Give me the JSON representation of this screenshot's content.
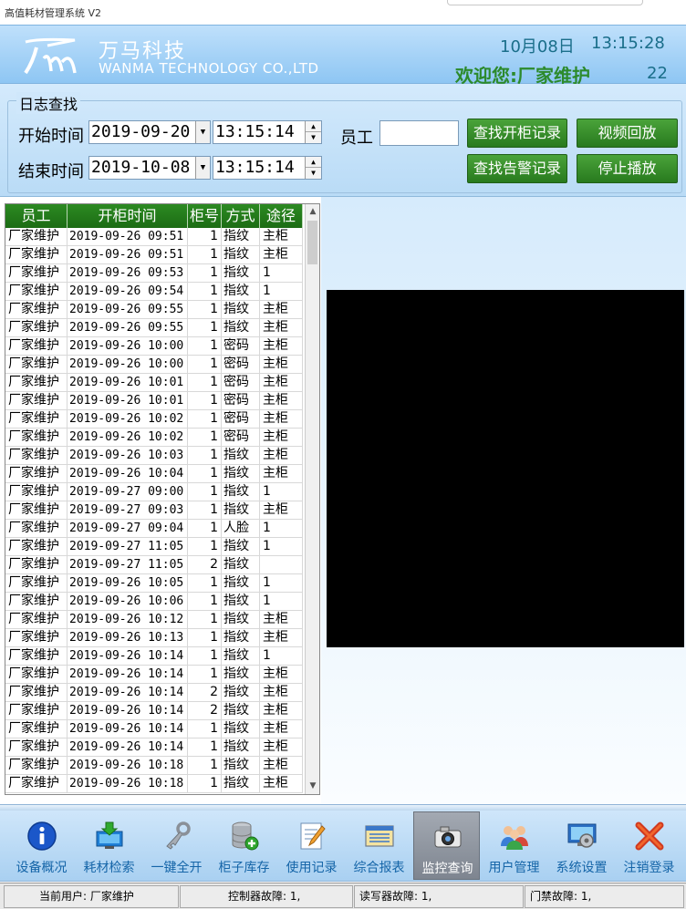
{
  "window": {
    "title": "高值耗材管理系统  V2"
  },
  "header": {
    "company_cn": "万马科技",
    "company_en": "WANMA TECHNOLOGY  CO.,LTD",
    "date": "10月08日",
    "time": "13:15:28",
    "welcome": "欢迎您:厂家维护",
    "count": "22"
  },
  "search": {
    "group_title": "日志查找",
    "start_label": "开始时间",
    "end_label": "结束时间",
    "start_date": "2019-09-20",
    "start_time": "13:15:14",
    "end_date": "2019-10-08",
    "end_time": "13:15:14",
    "staff_label": "员工",
    "staff_value": "",
    "btn_open_records": "查找开柜记录",
    "btn_alarm_records": "查找告警记录",
    "btn_video_playback": "视频回放",
    "btn_stop_playback": "停止播放"
  },
  "table": {
    "columns": [
      "员工",
      "开柜时间",
      "柜号",
      "方式",
      "途径"
    ],
    "rows": [
      [
        "厂家维护",
        "2019-09-26 09:51",
        "1",
        "指纹",
        "主柜"
      ],
      [
        "厂家维护",
        "2019-09-26 09:51",
        "1",
        "指纹",
        "主柜"
      ],
      [
        "厂家维护",
        "2019-09-26 09:53",
        "1",
        "指纹",
        "1"
      ],
      [
        "厂家维护",
        "2019-09-26 09:54",
        "1",
        "指纹",
        "1"
      ],
      [
        "厂家维护",
        "2019-09-26 09:55",
        "1",
        "指纹",
        "主柜"
      ],
      [
        "厂家维护",
        "2019-09-26 09:55",
        "1",
        "指纹",
        "主柜"
      ],
      [
        "厂家维护",
        "2019-09-26 10:00",
        "1",
        "密码",
        "主柜"
      ],
      [
        "厂家维护",
        "2019-09-26 10:00",
        "1",
        "密码",
        "主柜"
      ],
      [
        "厂家维护",
        "2019-09-26 10:01",
        "1",
        "密码",
        "主柜"
      ],
      [
        "厂家维护",
        "2019-09-26 10:01",
        "1",
        "密码",
        "主柜"
      ],
      [
        "厂家维护",
        "2019-09-26 10:02",
        "1",
        "密码",
        "主柜"
      ],
      [
        "厂家维护",
        "2019-09-26 10:02",
        "1",
        "密码",
        "主柜"
      ],
      [
        "厂家维护",
        "2019-09-26 10:03",
        "1",
        "指纹",
        "主柜"
      ],
      [
        "厂家维护",
        "2019-09-26 10:04",
        "1",
        "指纹",
        "主柜"
      ],
      [
        "厂家维护",
        "2019-09-27 09:00",
        "1",
        "指纹",
        "1"
      ],
      [
        "厂家维护",
        "2019-09-27 09:03",
        "1",
        "指纹",
        "主柜"
      ],
      [
        "厂家维护",
        "2019-09-27 09:04",
        "1",
        "人脸",
        "1"
      ],
      [
        "厂家维护",
        "2019-09-27 11:05",
        "1",
        "指纹",
        "1"
      ],
      [
        "厂家维护",
        "2019-09-27 11:05",
        "2",
        "指纹",
        ""
      ],
      [
        "厂家维护",
        "2019-09-26 10:05",
        "1",
        "指纹",
        "1"
      ],
      [
        "厂家维护",
        "2019-09-26 10:06",
        "1",
        "指纹",
        "1"
      ],
      [
        "厂家维护",
        "2019-09-26 10:12",
        "1",
        "指纹",
        "主柜"
      ],
      [
        "厂家维护",
        "2019-09-26 10:13",
        "1",
        "指纹",
        "主柜"
      ],
      [
        "厂家维护",
        "2019-09-26 10:14",
        "1",
        "指纹",
        "1"
      ],
      [
        "厂家维护",
        "2019-09-26 10:14",
        "1",
        "指纹",
        "主柜"
      ],
      [
        "厂家维护",
        "2019-09-26 10:14",
        "2",
        "指纹",
        "主柜"
      ],
      [
        "厂家维护",
        "2019-09-26 10:14",
        "2",
        "指纹",
        "主柜"
      ],
      [
        "厂家维护",
        "2019-09-26 10:14",
        "1",
        "指纹",
        "主柜"
      ],
      [
        "厂家维护",
        "2019-09-26 10:14",
        "1",
        "指纹",
        "主柜"
      ],
      [
        "厂家维护",
        "2019-09-26 10:18",
        "1",
        "指纹",
        "主柜"
      ],
      [
        "厂家维护",
        "2019-09-26 10:18",
        "1",
        "指纹",
        "主柜"
      ]
    ]
  },
  "toolbar": {
    "items": [
      {
        "label": "设备概况",
        "icon": "info-icon"
      },
      {
        "label": "耗材检索",
        "icon": "download-monitor-icon"
      },
      {
        "label": "一键全开",
        "icon": "key-icon"
      },
      {
        "label": "柜子库存",
        "icon": "database-add-icon"
      },
      {
        "label": "使用记录",
        "icon": "edit-document-icon"
      },
      {
        "label": "综合报表",
        "icon": "report-icon"
      },
      {
        "label": "监控查询",
        "icon": "camera-icon"
      },
      {
        "label": "用户管理",
        "icon": "users-icon"
      },
      {
        "label": "系统设置",
        "icon": "settings-monitor-icon"
      },
      {
        "label": "注销登录",
        "icon": "logout-x-icon"
      }
    ],
    "active": "监控查询"
  },
  "status": {
    "current_user": "当前用户: 厂家维护",
    "controller_fault": "控制器故障: 1,",
    "reader_fault": "读写器故障: 1,",
    "door_fault": "门禁故障: 1,"
  },
  "colors": {
    "header_bg": "#8ec6f3",
    "button_green": "#287a1e",
    "table_header": "#1c6c14",
    "toolbar_label": "#1565a8"
  }
}
